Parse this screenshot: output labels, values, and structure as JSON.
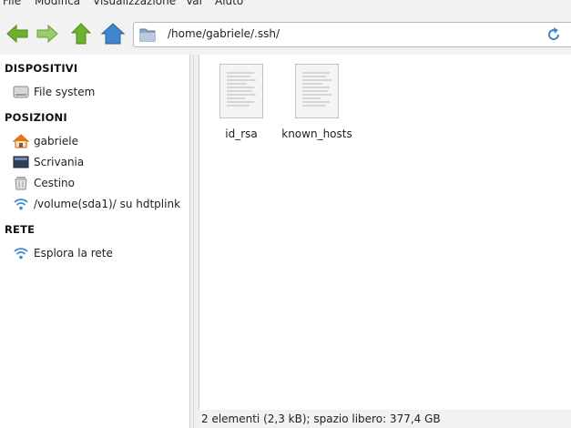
{
  "menubar": {
    "items": [
      "File",
      "Modifica",
      "Visualizzazione",
      "Vai",
      "Aiuto"
    ]
  },
  "toolbar": {
    "buttons": [
      {
        "name": "back-button",
        "icon": "arrow-left-icon",
        "color": "#6fb02e"
      },
      {
        "name": "forward-button",
        "icon": "arrow-right-icon",
        "color": "#6fb02e"
      },
      {
        "name": "up-button",
        "icon": "arrow-up-icon",
        "color": "#6fb02e"
      },
      {
        "name": "home-button",
        "icon": "home-icon",
        "color": "#3f86cf"
      }
    ],
    "address": "/home/gabriele/.ssh/"
  },
  "sidebar": {
    "sections": [
      {
        "title": "DISPOSITIVI",
        "items": [
          {
            "label": "File system",
            "icon": "drive-icon"
          }
        ]
      },
      {
        "title": "POSIZIONI",
        "items": [
          {
            "label": "gabriele",
            "icon": "home-icon"
          },
          {
            "label": "Scrivania",
            "icon": "desktop-icon"
          },
          {
            "label": "Cestino",
            "icon": "trash-icon"
          },
          {
            "label": "/volume(sda1)/ su hdtplink",
            "icon": "network-icon"
          }
        ]
      },
      {
        "title": "RETE",
        "items": [
          {
            "label": "Esplora la rete",
            "icon": "network-icon"
          }
        ]
      }
    ]
  },
  "files": [
    {
      "name": "id_rsa",
      "icon": "text-file-icon"
    },
    {
      "name": "known_hosts",
      "icon": "text-file-icon"
    }
  ],
  "status": "2 elementi (2,3 kB); spazio libero: 377,4 GB",
  "colors": {
    "accent_green": "#6fb02e",
    "accent_blue": "#3f86cf",
    "home_orange": "#e0791c"
  }
}
